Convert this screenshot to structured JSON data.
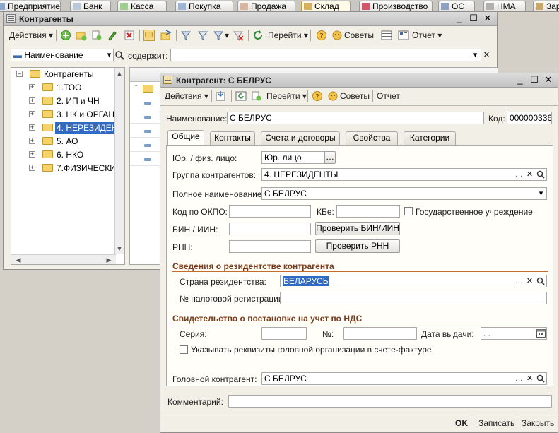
{
  "app_tabs": [
    "Предприятие",
    "Банк",
    "Касса",
    "Покупка",
    "Продажа",
    "Склад",
    "Производство",
    "ОС",
    "НМА",
    "Зар"
  ],
  "list_window": {
    "title": "Контрагенты",
    "toolbar": {
      "actions": "Действия",
      "goto": "Перейти",
      "help": "?",
      "tips": "Советы",
      "report": "Отчет"
    },
    "filter": {
      "field": "Наименование",
      "contains_label": "содержит:",
      "value": ""
    },
    "tree": {
      "root": "Контрагенты",
      "items": [
        "1.ТОО",
        "2. ИП и ЧН",
        "3. НК и ОРГАН",
        "4. НЕРЕЗИДЕН",
        "5. АО",
        "6. НКО",
        "7.ФИЗИЧЕСКИ"
      ],
      "selected_index": 3
    }
  },
  "form": {
    "title": "Контрагент: С БЕЛРУС",
    "toolbar": {
      "actions": "Действия",
      "goto": "Перейти",
      "help": "?",
      "tips": "Советы",
      "report": "Отчет"
    },
    "name_label": "Наименование:",
    "name_value": "С БЕЛРУС",
    "code_label": "Код:",
    "code_value": "000000336",
    "tabs": [
      "Общие",
      "Контакты",
      "Счета и договоры",
      "Свойства",
      "Категории"
    ],
    "active_tab": 0,
    "general": {
      "entity_type_label": "Юр. / физ. лицо:",
      "entity_type_value": "Юр. лицо",
      "group_label": "Группа контрагентов:",
      "group_value": "4. НЕРЕЗИДЕНТЫ",
      "full_name_label": "Полное наименование:",
      "full_name_value": "С БЕЛРУС",
      "okpo_label": "Код по ОКПО:",
      "okpo_value": "",
      "kbe_label": "КБе:",
      "kbe_value": "",
      "state_label": "Государственное учреждение",
      "state_checked": false,
      "bin_label": "БИН / ИИН:",
      "bin_value": "",
      "check_bin_button": "Проверить БИН/ИИН",
      "rnn_label": "РНН:",
      "rnn_value": "",
      "check_rnn_button": "Проверить РНН",
      "residency_section": "Сведения о резидентстве контрагента",
      "country_label": "Страна резидентства:",
      "country_value": "БЕЛАРУСЬ",
      "tax_reg_label": "№ налоговой регистрации:",
      "tax_reg_value": "",
      "vat_section": "Свидетельство о постановке на учет по НДС",
      "series_label": "Серия:",
      "series_value": "",
      "number_label": "№:",
      "number_value": "",
      "issue_date_label": "Дата выдачи:",
      "issue_date_value": " .  .",
      "head_org_label": "Указывать реквизиты головной организации в счете-фактуре",
      "head_org_checked": false,
      "head_counterparty_label": "Головной контрагент:",
      "head_counterparty_value": "С БЕЛРУС"
    },
    "comment_label": "Комментарий:",
    "comment_value": "",
    "footer": {
      "ok": "OK",
      "save": "Записать",
      "close": "Закрыть"
    }
  },
  "colors": {
    "accent": "#c86a2e",
    "section_text": "#7a3b1a",
    "selection": "#316ac5"
  }
}
